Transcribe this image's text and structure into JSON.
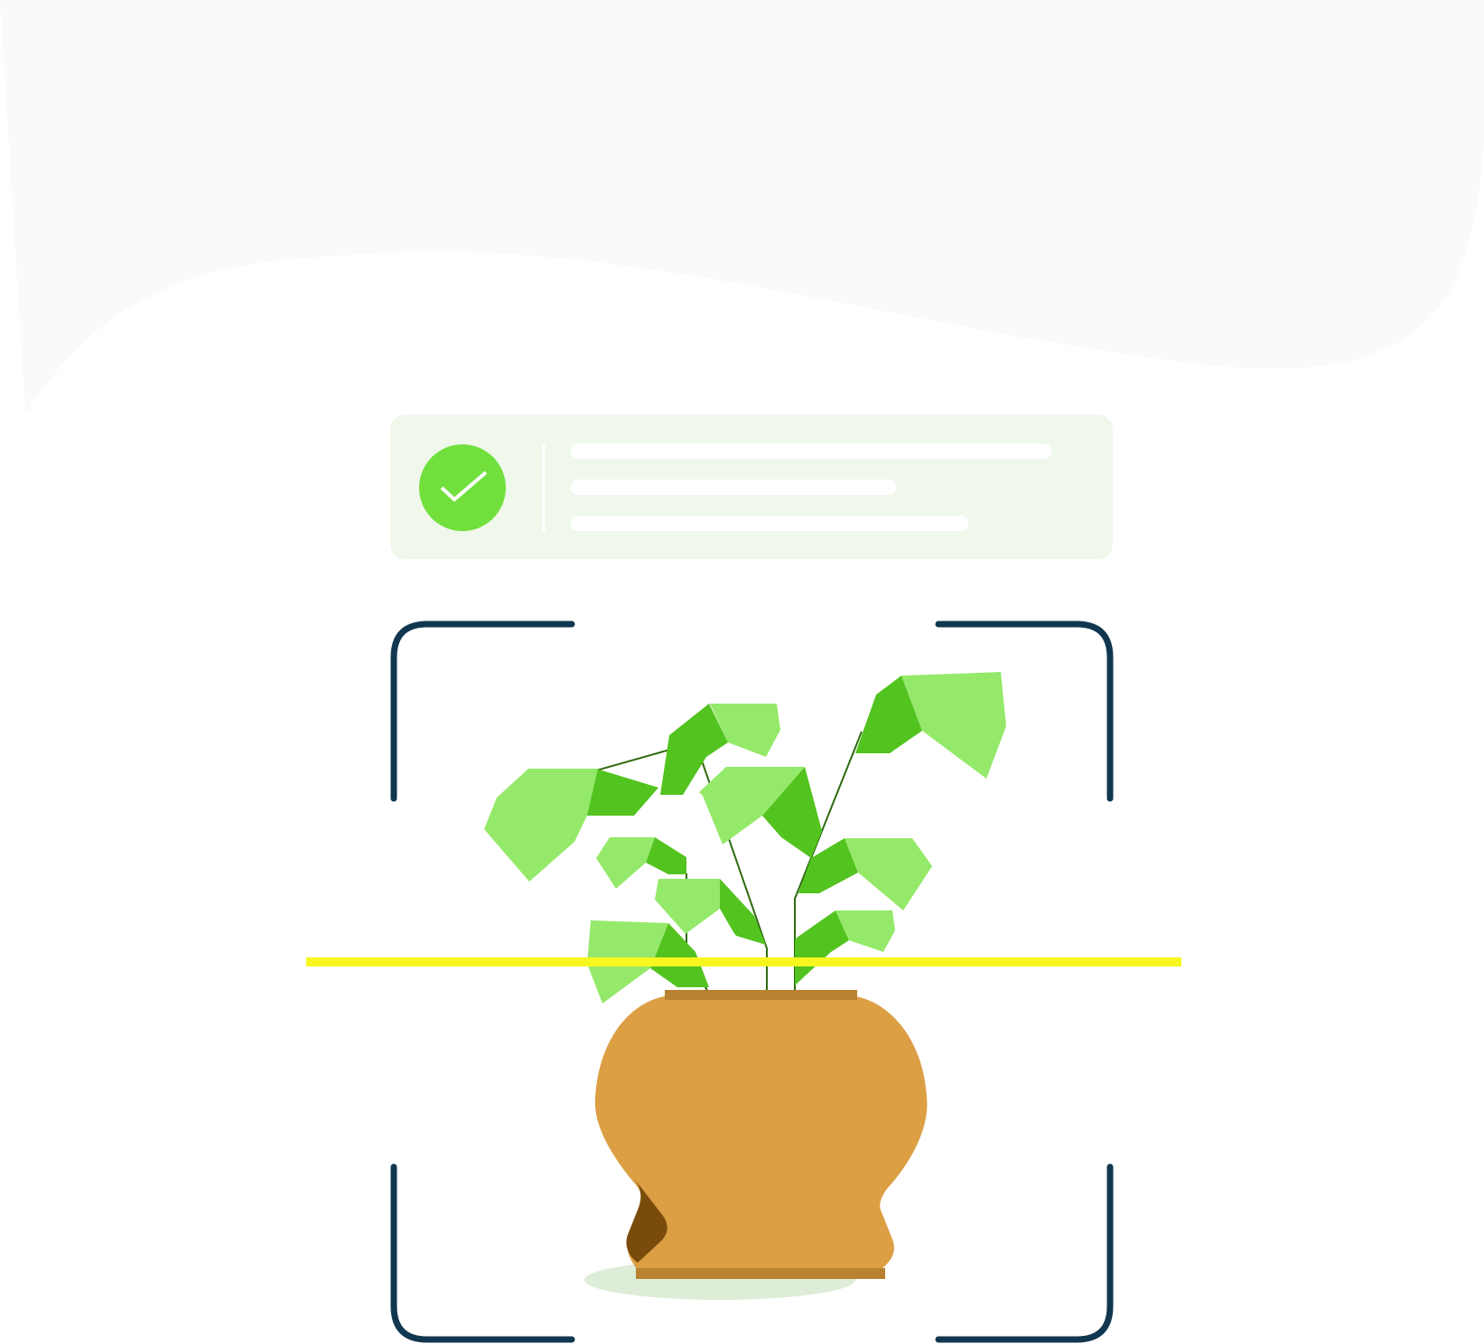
{
  "illustration": {
    "colors": {
      "background_blob": "#fafafa",
      "card_bg": "#f0f8ec",
      "check_circle": "#71e03c",
      "check_mark": "#ffffff",
      "text_placeholder": "#ffffff",
      "frame": "#10374f",
      "scan_line": "#f7f71f",
      "leaf_light": "#95e96a",
      "leaf_dark": "#52c31f",
      "stem": "#2f6b0f",
      "pot": "#dc9f44",
      "pot_rim": "#b88230",
      "pot_shade": "#7a4c0c",
      "shadow": "#deedd7"
    },
    "status_card": {
      "icon": "check-icon",
      "placeholder_lines": 3
    },
    "viewfinder": {
      "corners": [
        "top-left",
        "top-right",
        "bottom-left",
        "bottom-right"
      ],
      "icon": "scan-frame-icon"
    },
    "subject": {
      "icon": "potted-plant-icon"
    }
  }
}
